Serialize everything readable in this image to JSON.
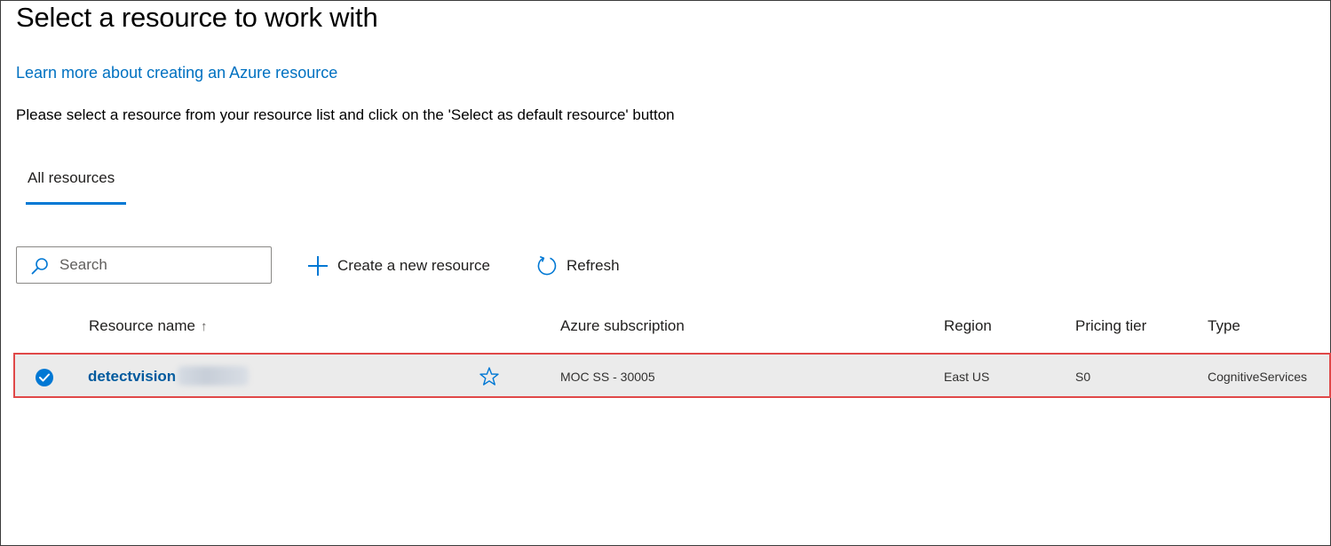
{
  "page": {
    "title": "Select a resource to work with",
    "learn_link": "Learn more about creating an Azure resource",
    "instructions": "Please select a resource from your resource list and click on the 'Select as default resource' button"
  },
  "tabs": [
    {
      "label": "All resources",
      "selected": true
    }
  ],
  "toolbar": {
    "search_placeholder": "Search",
    "search_value": "",
    "create_label": "Create a new resource",
    "refresh_label": "Refresh"
  },
  "table": {
    "columns": {
      "name": "Resource name",
      "sort_indicator": "↑",
      "subscription": "Azure subscription",
      "region": "Region",
      "tier": "Pricing tier",
      "type": "Type"
    },
    "rows": [
      {
        "name": "detectvision",
        "selected": true,
        "subscription": "MOC SS - 30005",
        "region": "East US",
        "tier": "S0",
        "type": "CognitiveServices"
      }
    ]
  },
  "colors": {
    "accent": "#0078d4",
    "link": "#0071c1",
    "selection_outline": "#e04848",
    "row_background": "#ebebeb"
  },
  "icons": {
    "search": "search-icon",
    "create": "plus-icon",
    "refresh": "refresh-icon",
    "favorite": "star-icon",
    "selected": "checkmark-circle-icon"
  }
}
